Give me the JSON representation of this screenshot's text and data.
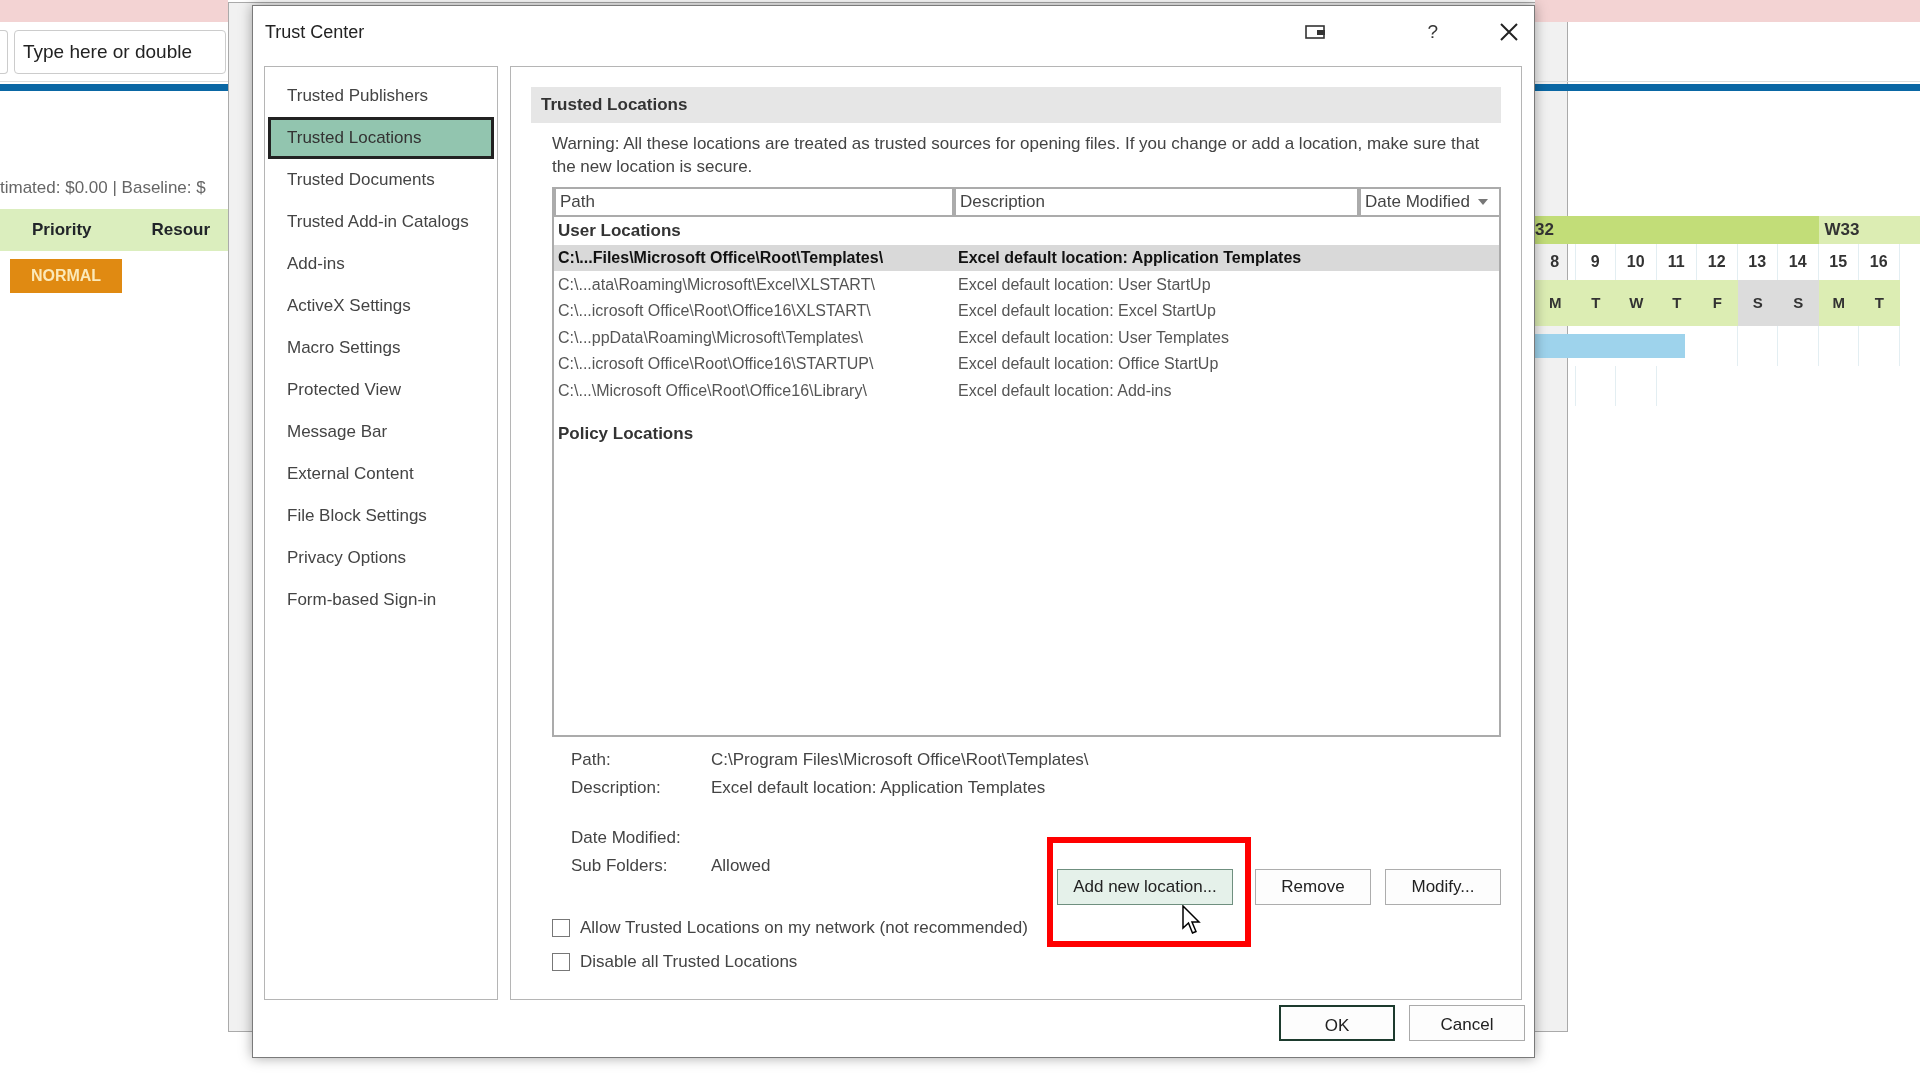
{
  "background": {
    "formula_bar": {
      "placeholder": "Type here or double"
    },
    "cost_summary": "timated: $0.00 | Baseline: $",
    "columns": [
      "Priority",
      "Resour"
    ],
    "priority": "NORMAL",
    "weeks": [
      {
        "label": "32"
      },
      {
        "label": "W33"
      }
    ],
    "days": [
      {
        "date": "8",
        "weekday": "M",
        "weekend": false
      },
      {
        "date": "9",
        "weekday": "T",
        "weekend": false
      },
      {
        "date": "10",
        "weekday": "W",
        "weekend": false
      },
      {
        "date": "11",
        "weekday": "T",
        "weekend": false
      },
      {
        "date": "12",
        "weekday": "F",
        "weekend": false
      },
      {
        "date": "13",
        "weekday": "S",
        "weekend": true
      },
      {
        "date": "14",
        "weekday": "S",
        "weekend": true
      },
      {
        "date": "15",
        "weekday": "M",
        "weekend": false
      },
      {
        "date": "16",
        "weekday": "T",
        "weekend": false
      }
    ]
  },
  "dialog": {
    "title": "Trust Center",
    "help": "?",
    "sidebar": [
      {
        "label": "Trusted Publishers",
        "selected": false
      },
      {
        "label": "Trusted Locations",
        "selected": true
      },
      {
        "label": "Trusted Documents",
        "selected": false
      },
      {
        "label": "Trusted Add-in Catalogs",
        "selected": false
      },
      {
        "label": "Add-ins",
        "selected": false
      },
      {
        "label": "ActiveX Settings",
        "selected": false
      },
      {
        "label": "Macro Settings",
        "selected": false
      },
      {
        "label": "Protected View",
        "selected": false
      },
      {
        "label": "Message Bar",
        "selected": false
      },
      {
        "label": "External Content",
        "selected": false
      },
      {
        "label": "File Block Settings",
        "selected": false
      },
      {
        "label": "Privacy Options",
        "selected": false
      },
      {
        "label": "Form-based Sign-in",
        "selected": false
      }
    ],
    "section_title": "Trusted Locations",
    "warning": "Warning: All these locations are treated as trusted sources for opening files.  If you change or add a location, make sure that the new location is secure.",
    "table": {
      "columns": [
        "Path",
        "Description",
        "Date Modified"
      ],
      "groups": [
        {
          "title": "User Locations",
          "rows": [
            {
              "path": "C:\\...Files\\Microsoft Office\\Root\\Templates\\",
              "description": "Excel default location: Application Templates",
              "selected": true
            },
            {
              "path": "C:\\...ata\\Roaming\\Microsoft\\Excel\\XLSTART\\",
              "description": "Excel default location: User StartUp",
              "selected": false
            },
            {
              "path": "C:\\...icrosoft Office\\Root\\Office16\\XLSTART\\",
              "description": "Excel default location: Excel StartUp",
              "selected": false
            },
            {
              "path": "C:\\...ppData\\Roaming\\Microsoft\\Templates\\",
              "description": "Excel default location: User Templates",
              "selected": false
            },
            {
              "path": "C:\\...icrosoft Office\\Root\\Office16\\STARTUP\\",
              "description": "Excel default location: Office StartUp",
              "selected": false
            },
            {
              "path": "C:\\...\\Microsoft Office\\Root\\Office16\\Library\\",
              "description": "Excel default location: Add-ins",
              "selected": false
            }
          ]
        },
        {
          "title": "Policy Locations"
        }
      ]
    },
    "details": [
      {
        "label": "Path:",
        "value": "C:\\Program Files\\Microsoft Office\\Root\\Templates\\"
      },
      {
        "label": "Description:",
        "value": "Excel default location: Application Templates"
      },
      {
        "label": "Date Modified:"
      },
      {
        "label": "Sub Folders:",
        "value": "Allowed"
      }
    ],
    "buttons": [
      {
        "label": "Add new location...",
        "hovered": true
      },
      {
        "label": "Remove",
        "hovered": false
      },
      {
        "label": "Modify...",
        "hovered": false
      }
    ],
    "checkboxes": [
      {
        "label": "Allow Trusted Locations on my network (not recommended)",
        "checked": false
      },
      {
        "label": "Disable all Trusted Locations",
        "checked": false
      }
    ],
    "footer_buttons": [
      {
        "label": "OK",
        "default": true
      },
      {
        "label": "Cancel",
        "default": false
      }
    ]
  }
}
